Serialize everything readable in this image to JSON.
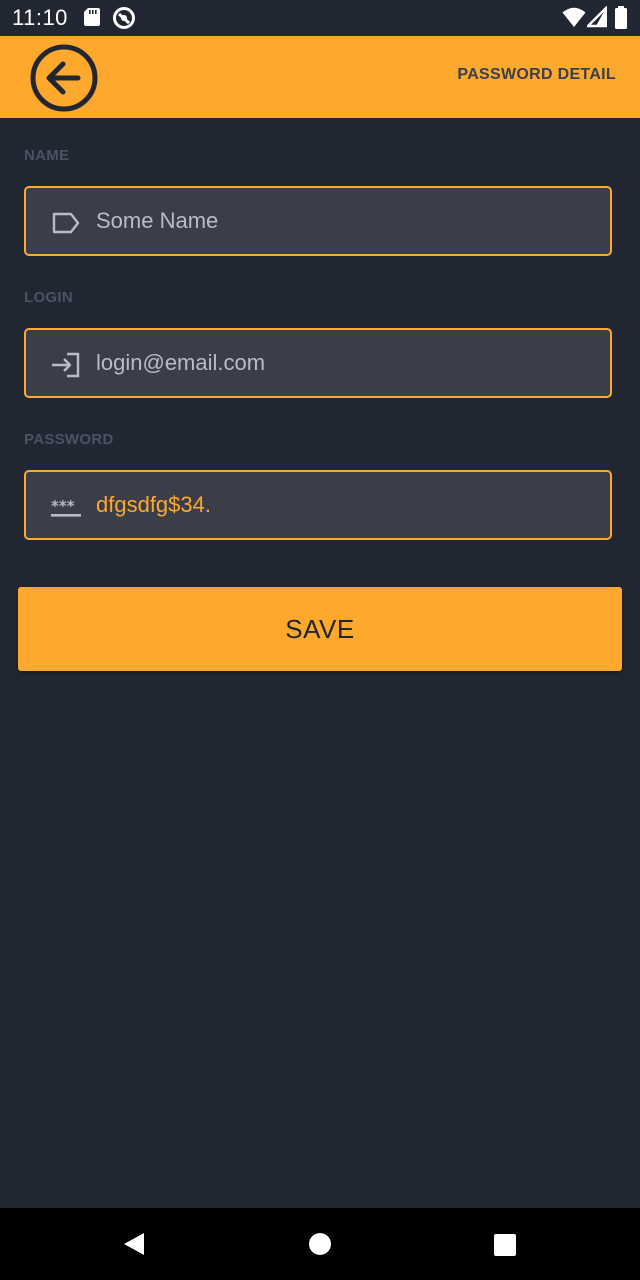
{
  "status_bar": {
    "time": "11:10",
    "icons": [
      "sd-card-icon",
      "vpn-icon",
      "wifi-icon",
      "signal-icon",
      "battery-icon"
    ]
  },
  "app_bar": {
    "title": "PASSWORD DETAIL",
    "back_icon": "back-arrow-icon"
  },
  "form": {
    "name": {
      "label": "NAME",
      "value": "Some Name",
      "icon": "label-tag-icon"
    },
    "login": {
      "label": "LOGIN",
      "value": "login@email.com",
      "icon": "login-arrow-icon"
    },
    "password": {
      "label": "PASSWORD",
      "value": "dfgsdfg$34.",
      "icon": "password-dots-icon"
    },
    "save_label": "SAVE"
  },
  "colors": {
    "accent": "#ffa82e",
    "background": "#212732",
    "field_background": "#3a3e49",
    "label": "#4b5262"
  },
  "nav_bar": {
    "buttons": [
      "back-triangle-icon",
      "home-circle-icon",
      "recents-square-icon"
    ]
  }
}
